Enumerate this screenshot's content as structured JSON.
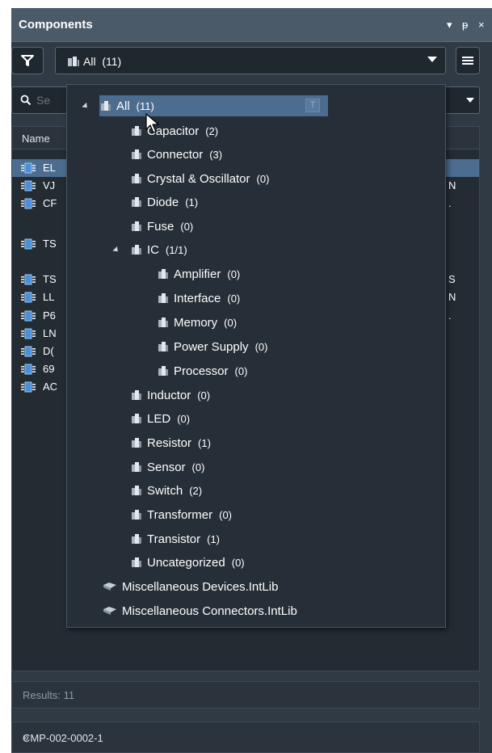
{
  "panel": {
    "title": "Components",
    "title_icons": {
      "dropdown": "▾",
      "pin": "ᵽ",
      "close": "×"
    }
  },
  "filter_button": {
    "icon": "filter-icon"
  },
  "category_combo": {
    "value": "All",
    "count": "(11)"
  },
  "menu_button": {
    "icon": "hamburger-icon"
  },
  "search": {
    "placeholder": "Se",
    "value": ""
  },
  "grid": {
    "header": "Name",
    "rows": [
      {
        "text": "EL",
        "tail": "",
        "selected": true
      },
      {
        "text": "VJ",
        "tail": "N",
        "selected": false
      },
      {
        "text": "CF",
        "tail": ".",
        "selected": false
      },
      {
        "text": "TS",
        "tail": "",
        "selected": false
      },
      {
        "text": "TS",
        "tail": "S",
        "selected": false
      },
      {
        "text": "LL",
        "tail": "N",
        "selected": false
      },
      {
        "text": "P6",
        "tail": ".",
        "selected": false
      },
      {
        "text": "LN",
        "tail": "",
        "selected": false
      },
      {
        "text": "D(",
        "tail": "",
        "selected": false
      },
      {
        "text": "69",
        "tail": "",
        "selected": false
      },
      {
        "text": "AC",
        "tail": "",
        "selected": false
      }
    ]
  },
  "results": "Results: 11",
  "bottom": {
    "label": "CMP-002-0002-1",
    "chevron": "»"
  },
  "tree": {
    "root": {
      "name": "All",
      "count": "(11)",
      "badge": "T"
    },
    "categories": [
      {
        "name": "Capacitor",
        "count": "(2)"
      },
      {
        "name": "Connector",
        "count": "(3)"
      },
      {
        "name": "Crystal & Oscillator",
        "count": "(0)"
      },
      {
        "name": "Diode",
        "count": "(1)"
      },
      {
        "name": "Fuse",
        "count": "(0)"
      },
      {
        "name": "IC",
        "count": "(1/1)"
      },
      {
        "name": "Amplifier",
        "count": "(0)"
      },
      {
        "name": "Interface",
        "count": "(0)"
      },
      {
        "name": "Memory",
        "count": "(0)"
      },
      {
        "name": "Power Supply",
        "count": "(0)"
      },
      {
        "name": "Processor",
        "count": "(0)"
      },
      {
        "name": "Inductor",
        "count": "(0)"
      },
      {
        "name": "LED",
        "count": "(0)"
      },
      {
        "name": "Resistor",
        "count": "(1)"
      },
      {
        "name": "Sensor",
        "count": "(0)"
      },
      {
        "name": "Switch",
        "count": "(2)"
      },
      {
        "name": "Transformer",
        "count": "(0)"
      },
      {
        "name": "Transistor",
        "count": "(1)"
      },
      {
        "name": "Uncategorized",
        "count": "(0)"
      }
    ],
    "libraries": [
      {
        "name": "Miscellaneous Devices.IntLib"
      },
      {
        "name": "Miscellaneous Connectors.IntLib"
      }
    ]
  },
  "colors": {
    "panel_bg": "#2f3a45",
    "titlebar_bg": "#4b5a69",
    "selection": "#4c6d8f",
    "dropdown_bg": "#262e37"
  }
}
